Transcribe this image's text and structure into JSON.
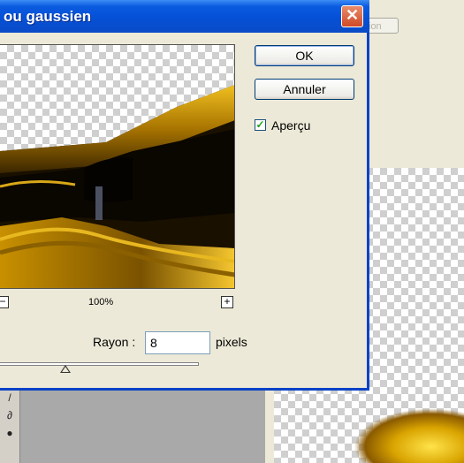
{
  "dialog": {
    "title": "ou gaussien",
    "close_glyph": "✕",
    "ok_label": "OK",
    "cancel_label": "Annuler",
    "preview_label": "Aperçu",
    "preview_checked": true,
    "zoom_out_glyph": "−",
    "zoom_in_glyph": "+",
    "zoom_label": "100%",
    "radius_label": "Rayon :",
    "radius_value": "8",
    "radius_unit": "pixels",
    "radius_slider_fraction": 0.33
  },
  "background": {
    "option_button_label": "ion"
  },
  "colors": {
    "titlebar": "#0550d6",
    "dialog_bg": "#ece9d8",
    "close_button": "#cf4a27",
    "gold": "#d9a400"
  },
  "icons": [
    "close-icon",
    "zoom-out-icon",
    "zoom-in-icon",
    "checkmark-icon",
    "slider-thumb-icon"
  ]
}
